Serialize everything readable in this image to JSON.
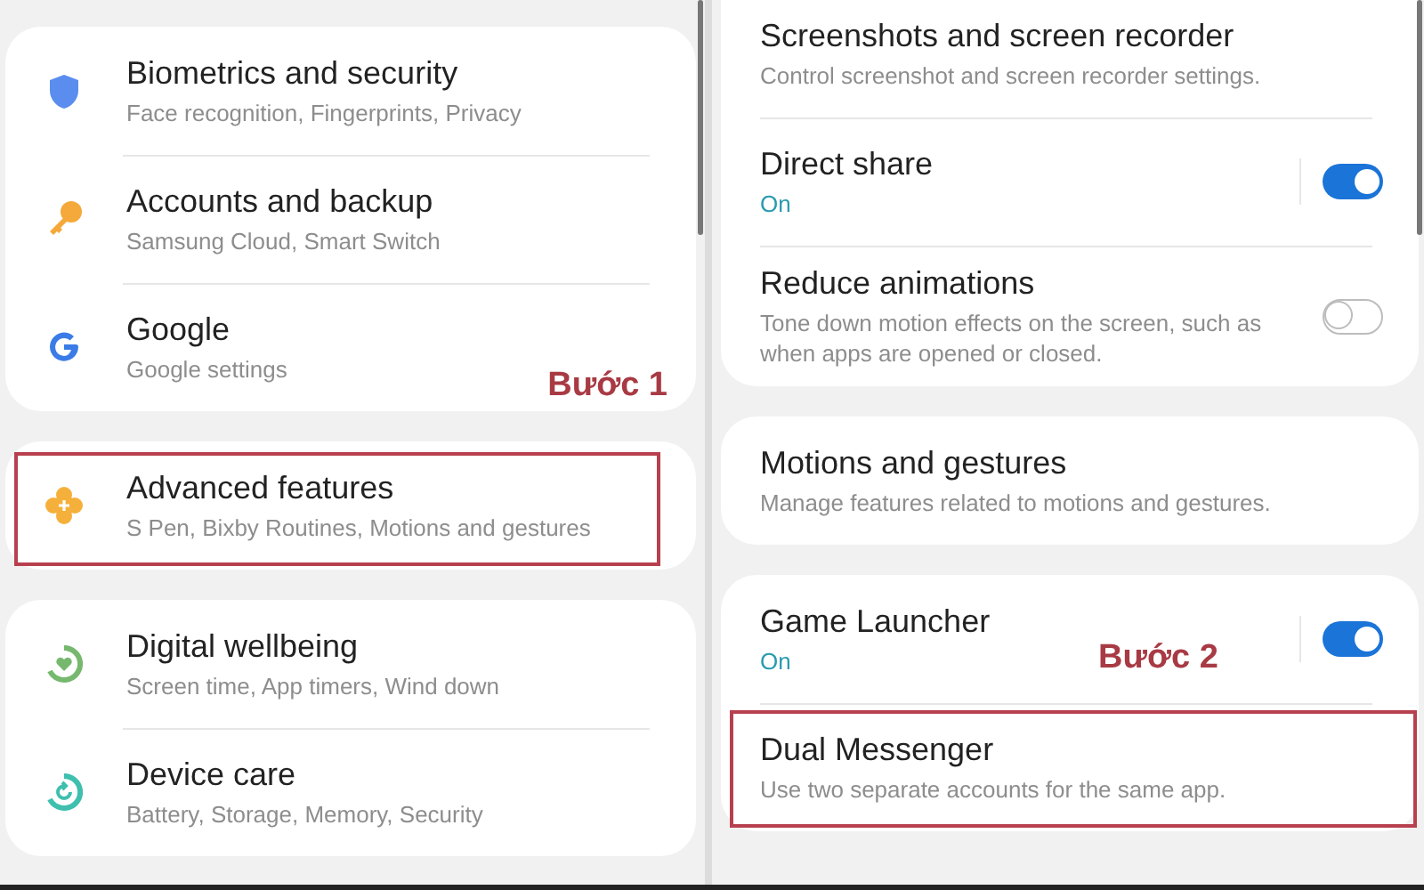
{
  "panels": [
    {
      "groups": [
        {
          "items": [
            {
              "title": "Biometrics and security",
              "subtitle": "Face recognition, Fingerprints, Privacy",
              "highlighted": false
            },
            {
              "title": "Accounts and backup",
              "subtitle": "Samsung Cloud, Smart Switch",
              "highlighted": false
            },
            {
              "title": "Google",
              "subtitle": "Google settings",
              "highlighted": false
            }
          ],
          "annotation": "Bước 1"
        },
        {
          "items": [
            {
              "title": "Advanced features",
              "subtitle": "S Pen, Bixby Routines, Motions and gestures",
              "highlighted": true
            }
          ]
        },
        {
          "items": [
            {
              "title": "Digital wellbeing",
              "subtitle": "Screen time, App timers, Wind down",
              "highlighted": false
            },
            {
              "title": "Device care",
              "subtitle": "Battery, Storage, Memory, Security",
              "highlighted": false
            }
          ]
        }
      ]
    },
    {
      "groups": [
        {
          "items": [
            {
              "title": "Screenshots and screen recorder",
              "subtitle": "Control screenshot and screen recorder settings.",
              "highlighted": false
            },
            {
              "title": "Direct share",
              "status": "On",
              "toggle": {
                "on": true
              },
              "highlighted": false
            },
            {
              "title": "Reduce animations",
              "subtitle": "Tone down motion effects on the screen, such as when apps are opened or closed.",
              "toggle": {
                "on": false
              },
              "highlighted": false
            }
          ]
        },
        {
          "items": [
            {
              "title": "Motions and gestures",
              "subtitle": "Manage features related to motions and gestures.",
              "highlighted": false
            }
          ]
        },
        {
          "items": [
            {
              "title": "Game Launcher",
              "status": "On",
              "toggle": {
                "on": true
              },
              "highlighted": false
            },
            {
              "title": "Dual Messenger",
              "subtitle": "Use two separate accounts for the same app.",
              "highlighted": true
            }
          ],
          "annotation": "Bước 2"
        }
      ]
    }
  ]
}
